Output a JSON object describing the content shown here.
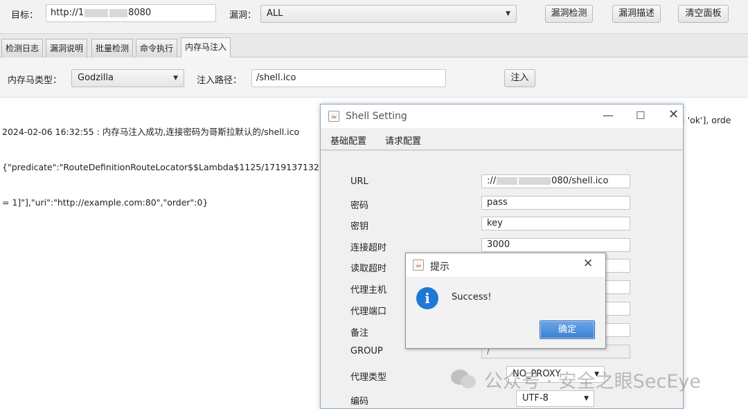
{
  "toolbar": {
    "target_label": "目标：",
    "target_value_prefix": "http://1",
    "target_value_suffix": "8080",
    "vuln_label": "漏洞：",
    "vuln_value": "ALL",
    "detect_button": "漏洞检测",
    "describe_button": "漏洞描述",
    "clear_button": "清空面板"
  },
  "tabs": [
    {
      "label": "检测日志"
    },
    {
      "label": "漏洞说明"
    },
    {
      "label": "批量检测"
    },
    {
      "label": "命令执行"
    },
    {
      "label": "内存马注入",
      "active": true
    }
  ],
  "injection": {
    "type_label": "内存马类型：",
    "type_value": "Godzilla",
    "path_label": "注入路径：",
    "path_value": "/shell.ico",
    "inject_button": "注入"
  },
  "log": {
    "line1": "2024-02-06 16:32:55 : 内存马注入成功,连接密码为哥斯拉默认的/shell.ico",
    "line2_left": "{\"predicate\":\"RouteDefinitionRouteLocator$$Lambda$1125/1719137132\",\"",
    "line2_right": "ult = 'ok'], orde",
    "line3": "= 1]\"],\"uri\":\"http://example.com:80\",\"order\":0}"
  },
  "shell_window": {
    "title": "Shell Setting",
    "tabs": [
      "基础配置",
      "请求配置"
    ],
    "fields": [
      {
        "label": "URL",
        "value_prefix": "://",
        "value_suffix": "080/shell.ico"
      },
      {
        "label": "密码",
        "value": "pass"
      },
      {
        "label": "密钥",
        "value": "key"
      },
      {
        "label": "连接超时",
        "value": "3000"
      },
      {
        "label": "读取超时",
        "value": ""
      },
      {
        "label": "代理主机",
        "value": ""
      },
      {
        "label": "代理端口",
        "value": ""
      },
      {
        "label": "备注",
        "value": ""
      },
      {
        "label": "GROUP",
        "value": "/"
      },
      {
        "label": "代理类型",
        "value": "NO_PROXY"
      },
      {
        "label": "编码",
        "value": "UTF-8"
      }
    ]
  },
  "dialog": {
    "title": "提示",
    "message": "Success!",
    "ok_button": "确定"
  },
  "watermark": {
    "text": "公众号 · 安全之眼SecEye"
  },
  "colors": {
    "accent": "#3c7fd2",
    "info_icon": "#1e78d6",
    "window_border": "#8aa9c9"
  },
  "icons": [
    "java-cup-icon",
    "info-icon",
    "chevron-down-icon",
    "close-icon",
    "minimize-icon",
    "maximize-icon",
    "wechat-icon"
  ]
}
